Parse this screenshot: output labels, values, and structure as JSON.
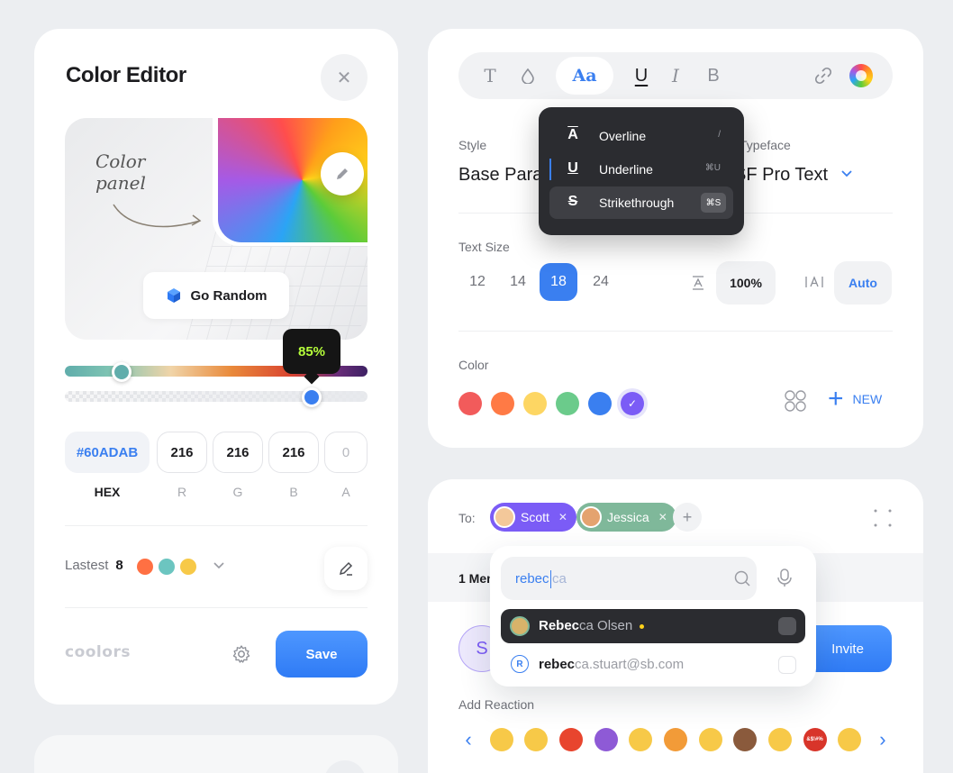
{
  "color_editor": {
    "title": "Color Editor",
    "handwritten_note": "Color panel",
    "random_button": "Go Random",
    "opacity_tooltip": "85%",
    "opacity_percent": 85,
    "hue_position_fraction": 0.16,
    "hex_value": "#60ADAB",
    "r_value": "216",
    "g_value": "216",
    "b_value": "216",
    "a_value": "0",
    "labels": {
      "hex": "HEX",
      "r": "R",
      "g": "G",
      "b": "B",
      "a": "A"
    },
    "latest_label": "Lastest",
    "latest_count": "8",
    "latest_colors": [
      "#ff7043",
      "#6cc5c0",
      "#f7c948"
    ],
    "brand": "coolors",
    "save_label": "Save",
    "icons": [
      "close-icon",
      "pencil-icon",
      "cube-icon",
      "eyedropper-icon",
      "gear-icon",
      "chevron-down-icon"
    ]
  },
  "text_style": {
    "toolbar": {
      "text_tool": "T",
      "aa_label": "Aa",
      "underline_glyph": "U",
      "italic_glyph": "I",
      "bold_glyph": "B"
    },
    "style_label": "Style",
    "style_value": "Base Parag",
    "typeface_label": "Typeface",
    "typeface_value": "SF Pro Text",
    "text_size_label": "Text Size",
    "sizes": [
      "12",
      "14",
      "18",
      "24"
    ],
    "selected_size": "18",
    "line_height_value": "100%",
    "letter_spacing_value": "Auto",
    "color_label": "Color",
    "colors": [
      "#f25b5b",
      "#ff7a45",
      "#fdd663",
      "#6bcb8b",
      "#3a7ff0",
      "#7b5cf6"
    ],
    "selected_color": "#7b5cf6",
    "new_label": "NEW"
  },
  "decoration_menu": {
    "items": [
      {
        "icon": "A",
        "label": "Overline",
        "shortcut": "/"
      },
      {
        "icon": "U",
        "label": "Underline",
        "shortcut": "⌘U"
      },
      {
        "icon": "S",
        "label": "Strikethrough",
        "shortcut": "⌘S"
      }
    ]
  },
  "share": {
    "to_label": "To:",
    "recipients": [
      {
        "name": "Scott",
        "color": "#7b5cf6"
      },
      {
        "name": "Jessica",
        "color": "#7fb89a"
      }
    ],
    "members_label": "1 Member",
    "avatar_initial": "S",
    "invite_label": "Invite",
    "reaction_label": "Add Reaction",
    "emojis": [
      {
        "name": "party-face-icon",
        "color": "#f7c948"
      },
      {
        "name": "sunglasses-face-icon",
        "color": "#f7c948"
      },
      {
        "name": "angry-face-icon",
        "color": "#e8452e"
      },
      {
        "name": "devil-face-icon",
        "color": "#8e5ad6"
      },
      {
        "name": "woozy-face-icon",
        "color": "#f7c948"
      },
      {
        "name": "party-popper-icon",
        "color": "#f29b38"
      },
      {
        "name": "kissing-face-icon",
        "color": "#f7c948"
      },
      {
        "name": "poop-icon",
        "color": "#8a5a3c"
      },
      {
        "name": "rock-hand-icon",
        "color": "#f7c948"
      },
      {
        "name": "cursing-face-icon",
        "color": "#d8352a",
        "text": "&$!#%"
      },
      {
        "name": "smiling-hearts-face-icon",
        "color": "#f7c948"
      }
    ]
  },
  "search": {
    "typed": "rebec",
    "suggestion_rest": "ca",
    "results": [
      {
        "match": "Rebec",
        "rest": "ca Olsen"
      },
      {
        "avatar": "R",
        "match": "rebec",
        "rest": "ca.stuart@sb.com"
      }
    ]
  }
}
